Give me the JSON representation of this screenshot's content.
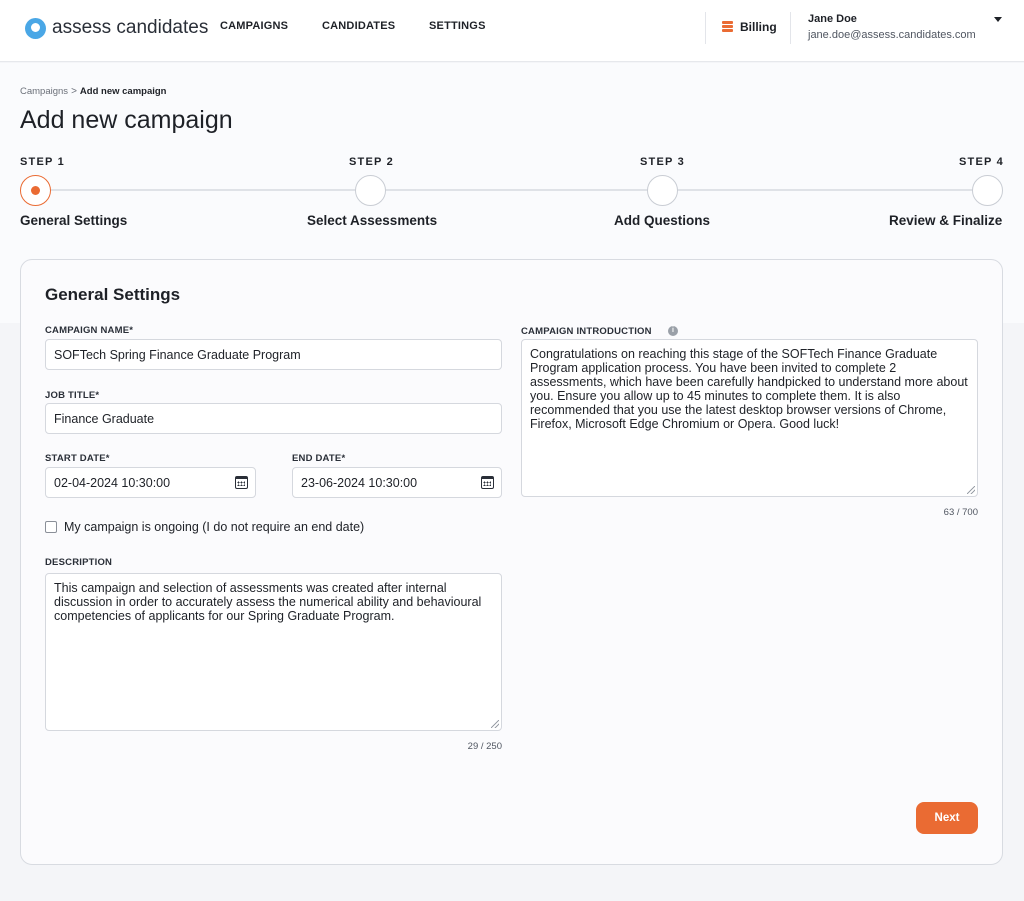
{
  "brand": {
    "name": "assess candidates",
    "accent": "#ea6b33",
    "logo_color": "#4aa7e6"
  },
  "nav": {
    "campaigns": "CAMPAIGNS",
    "candidates": "CANDIDATES",
    "settings": "SETTINGS"
  },
  "billing": {
    "label": "Billing",
    "icon": "stack-icon"
  },
  "user": {
    "name": "Jane Doe",
    "email": "jane.doe@assess.candidates.com"
  },
  "breadcrumb": {
    "parent": "Campaigns",
    "separator": ">",
    "current": "Add new campaign"
  },
  "page_title": "Add new campaign",
  "steps": [
    {
      "label": "STEP 1",
      "name": "General Settings",
      "state": "active"
    },
    {
      "label": "STEP 2",
      "name": "Select Assessments",
      "state": "pending"
    },
    {
      "label": "STEP 3",
      "name": "Add Questions",
      "state": "pending"
    },
    {
      "label": "STEP 4",
      "name": "Review & Finalize",
      "state": "pending"
    }
  ],
  "form": {
    "title": "General Settings",
    "campaign_name": {
      "label": "CAMPAIGN NAME*",
      "value": "SOFTech Spring Finance Graduate Program"
    },
    "job_title": {
      "label": "JOB TITLE*",
      "value": "Finance Graduate"
    },
    "start_date": {
      "label": "START DATE*",
      "value": "02-04-2024 10:30:00"
    },
    "end_date": {
      "label": "END DATE*",
      "value": "23-06-2024 10:30:00"
    },
    "ongoing": {
      "label": "My campaign is ongoing (I do not require an end date)",
      "checked": false
    },
    "description": {
      "label": "DESCRIPTION",
      "value": "This campaign and selection of assessments was created after internal discussion in order to accurately assess the numerical ability and behavioural competencies of applicants for our Spring Graduate Program.",
      "counter": "29 / 250"
    },
    "introduction": {
      "label": "CAMPAIGN INTRODUCTION",
      "value": "Congratulations on reaching this stage of the SOFTech Finance Graduate Program application process. You have been invited to complete 2 assessments, which have been carefully handpicked to understand more about you. Ensure you allow up to 45 minutes to complete them. It is also recommended that you use the latest desktop browser versions of Chrome, Firefox, Microsoft Edge Chromium or Opera. Good luck!",
      "counter": "63 / 700",
      "info": "i"
    },
    "next_label": "Next"
  }
}
